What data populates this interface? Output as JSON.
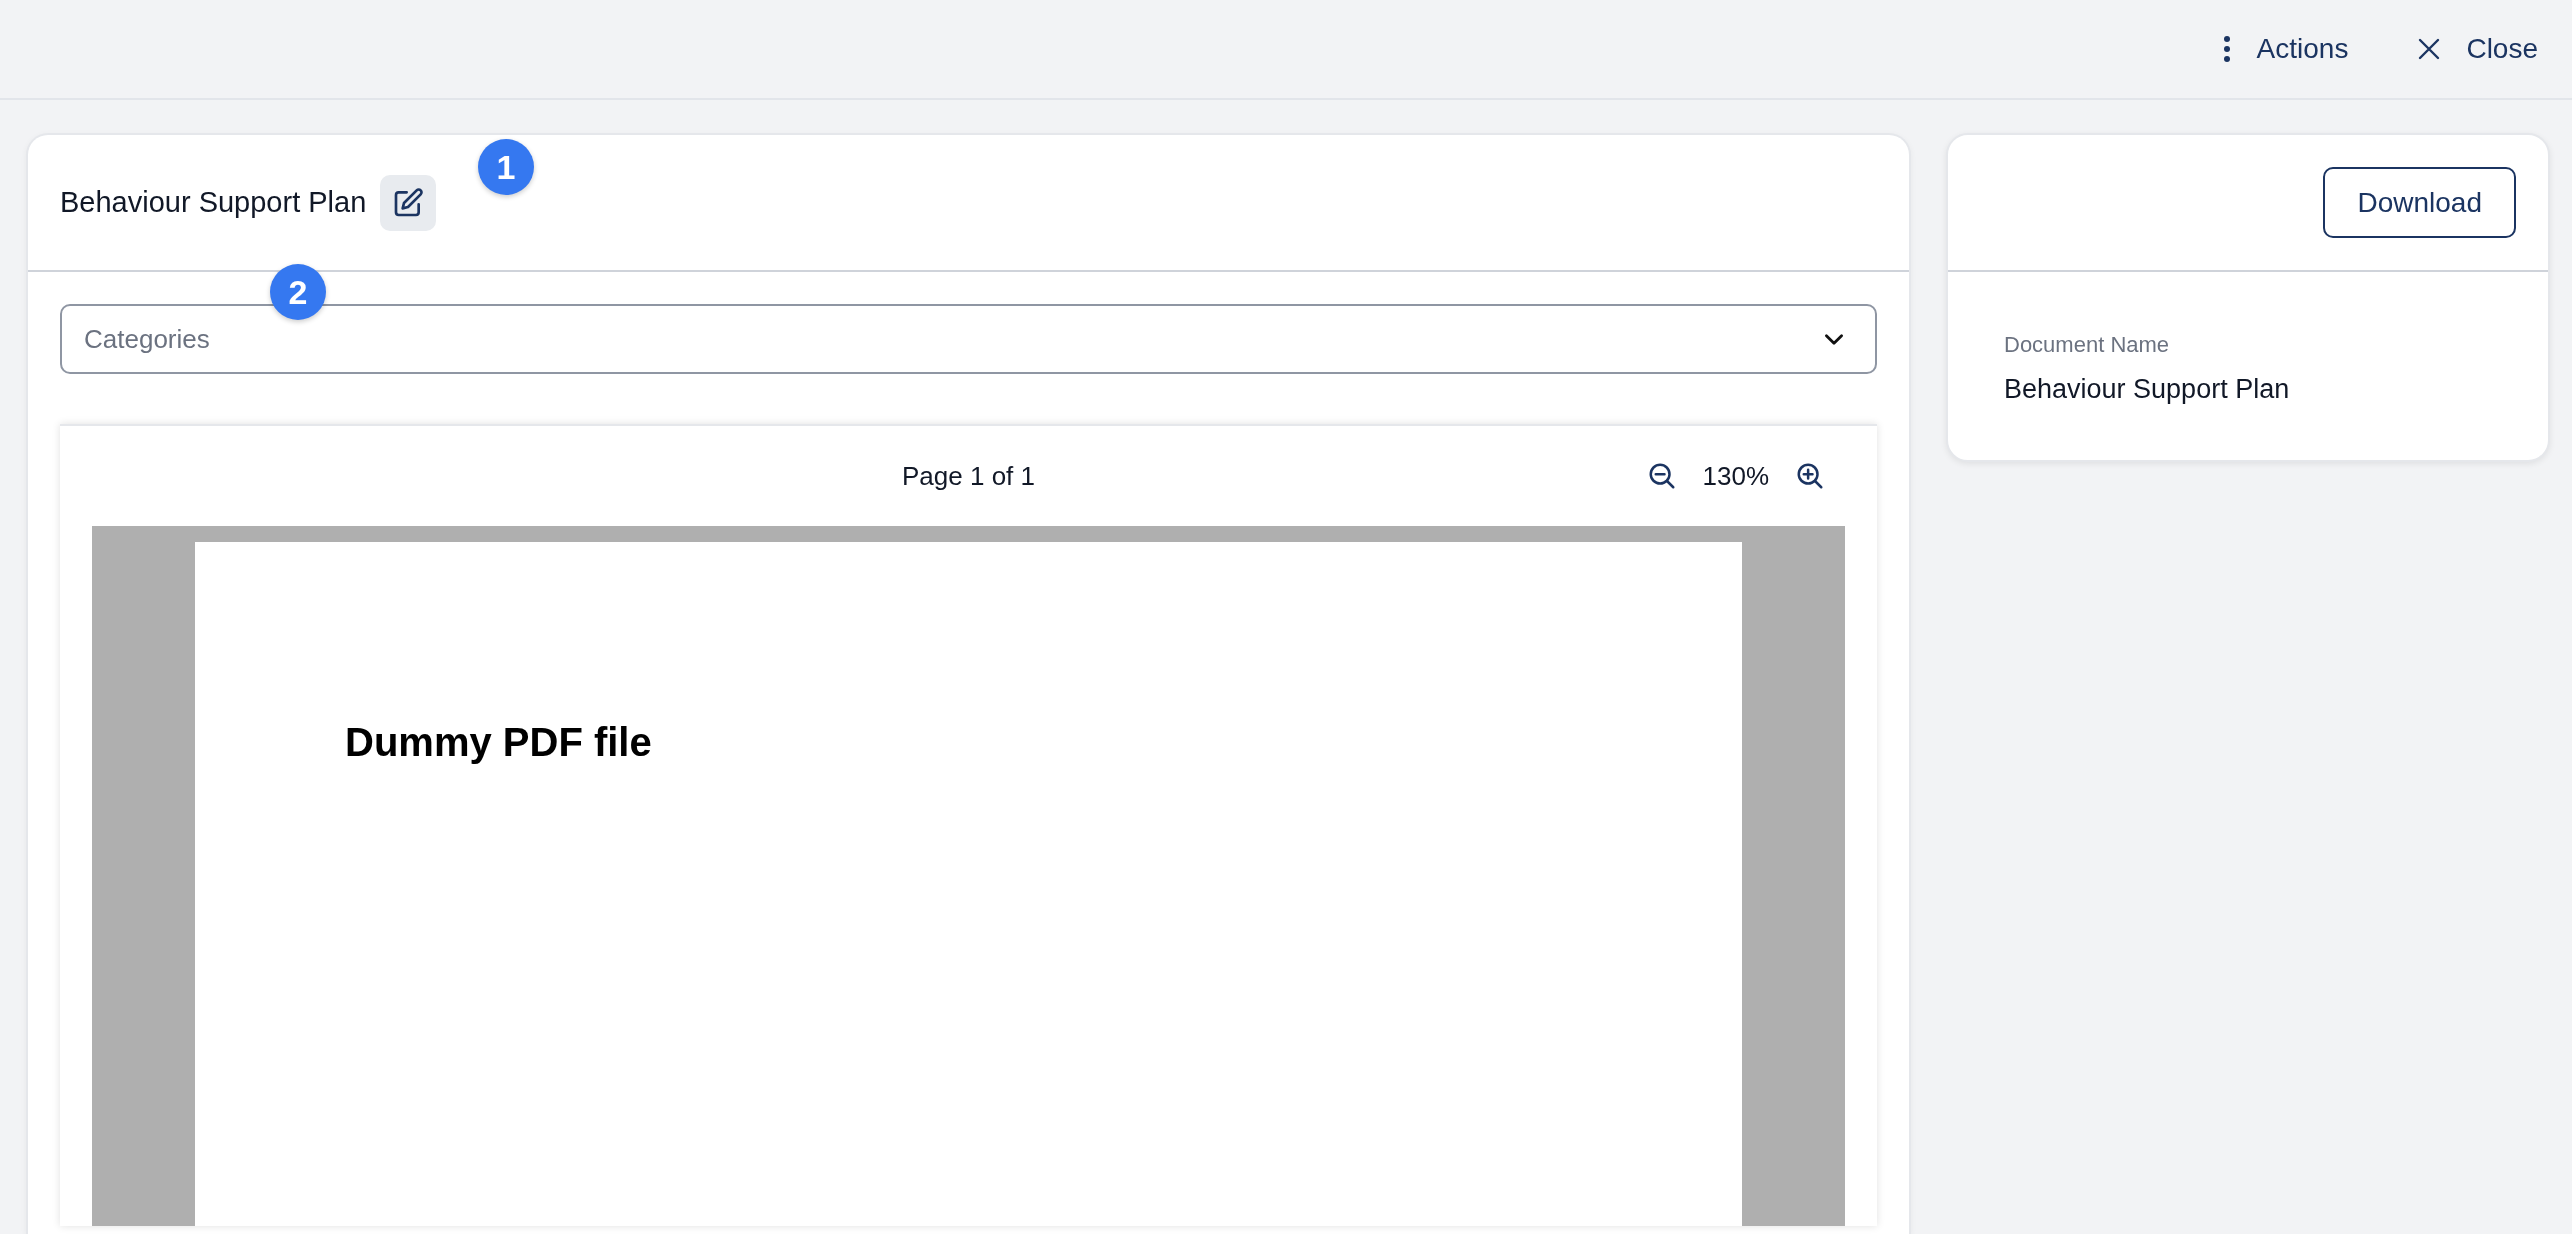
{
  "top_bar": {
    "actions": [
      {
        "kind": "menu",
        "label": "Actions"
      },
      {
        "kind": "close",
        "label": "Close"
      }
    ]
  },
  "document_card": {
    "title": "Behaviour Support Plan",
    "edit_marker": "1",
    "categories": {
      "placeholder": "Categories",
      "marker": "2"
    },
    "viewer": {
      "page_label": "Page 1 of 1",
      "zoom": "130%",
      "page_heading": "Dummy PDF file"
    }
  },
  "details_card": {
    "download": "Download",
    "fields": [
      {
        "label": "Document Name",
        "value": "Behaviour Support Plan"
      }
    ]
  }
}
